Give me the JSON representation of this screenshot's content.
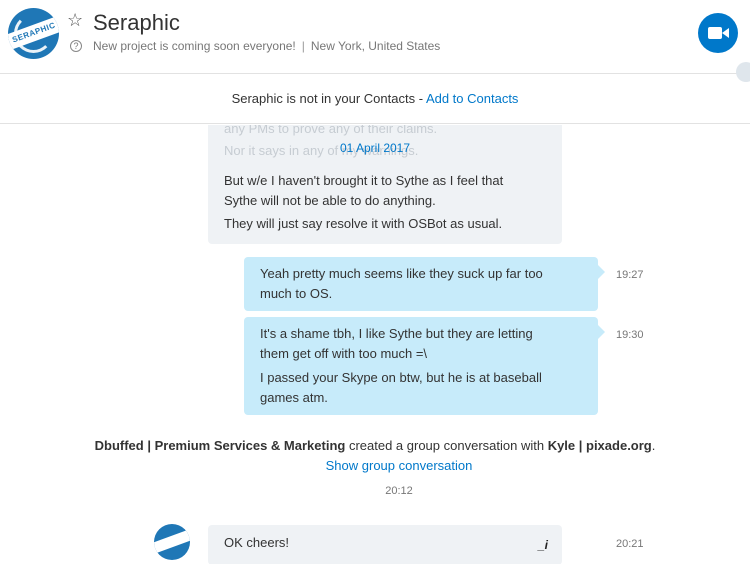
{
  "header": {
    "avatar_text": "SERAPHIC",
    "contact_name": "Seraphic",
    "mood_message": "New project is coming soon everyone!",
    "location": "New York, United States",
    "separator": "|"
  },
  "notice": {
    "text": "Seraphic is not in your Contacts - ",
    "link": "Add to Contacts"
  },
  "messages": {
    "ghost_line_1": "any PMs to prove any of their claims.",
    "ghost_line_2": "Nor it says in any of my warnings.",
    "date_separator": "01 April 2017",
    "incoming_1_line_1": "But w/e I haven't brought it to Sythe as I feel that",
    "incoming_1_line_2": "Sythe will not be able to do anything.",
    "incoming_1_line_3": "They will just say resolve it with OSBot as usual.",
    "outgoing_1_line_1": "Yeah pretty much seems like they suck up far too",
    "outgoing_1_line_2": "much to OS.",
    "outgoing_1_time": "19:27",
    "outgoing_2_line_1": "It's a shame tbh, I like Sythe but they are letting",
    "outgoing_2_line_2": "them get off with too much =\\",
    "outgoing_2_line_3": "I passed your Skype on btw, but he is at baseball",
    "outgoing_2_line_4": "games atm.",
    "outgoing_2_time": "19:30",
    "system_creator": "Dbuffed | Premium Services & Marketing",
    "system_action": " created a group conversation with ",
    "system_target": "Kyle | pixade.org",
    "system_period": ".",
    "system_link": "Show group conversation",
    "system_time": "20:12",
    "incoming_2_text": "OK cheers!",
    "incoming_2_time": "20:21"
  },
  "colors": {
    "accent": "#0078ca",
    "outgoing_bubble": "#c7ebfa",
    "incoming_bubble": "#eff2f5"
  },
  "icons": [
    "star-icon",
    "help-icon",
    "video-call-icon"
  ]
}
